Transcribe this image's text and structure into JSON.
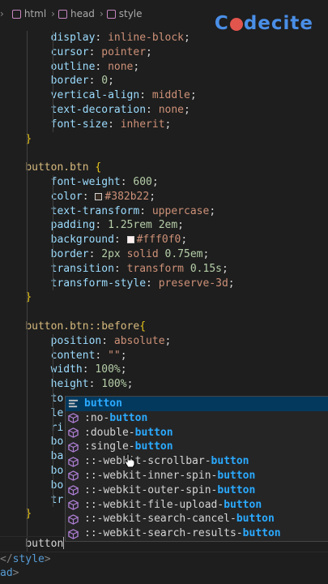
{
  "breadcrumb": {
    "items": [
      {
        "label": "html"
      },
      {
        "label": "head"
      },
      {
        "label": "style"
      }
    ]
  },
  "brand": {
    "logo_text_a": "C",
    "logo_text_b": "decite"
  },
  "colors": {
    "swatch_color": "#382b22",
    "swatch_bg": "#fff0f0",
    "logo_blue": "#4a8fe7",
    "logo_red": "#e2554d",
    "highlight": "#2aaaff"
  },
  "code": {
    "block1": [
      {
        "prop": "display",
        "val": "inline-block"
      },
      {
        "prop": "cursor",
        "val": "pointer"
      },
      {
        "prop": "outline",
        "val": "none"
      },
      {
        "prop": "border",
        "num": "0"
      },
      {
        "prop": "vertical-align",
        "val": "middle"
      },
      {
        "prop": "text-decoration",
        "val": "none"
      },
      {
        "prop": "font-size",
        "val": "inherit"
      }
    ],
    "selector2": "button.btn",
    "block2": [
      {
        "prop": "font-weight",
        "num": "600"
      },
      {
        "prop": "color",
        "val": "#382b22"
      },
      {
        "prop": "text-transform",
        "val": "uppercase"
      },
      {
        "prop": "padding",
        "num": "1.25rem 2em"
      },
      {
        "prop": "background",
        "val": "#fff0f0"
      },
      {
        "prop": "border",
        "num": "2px",
        "val": "solid",
        "num2": "0.75em"
      },
      {
        "prop": "transition",
        "val": "transform",
        "num": "0.15s"
      },
      {
        "prop": "transform-style",
        "val": "preserve-3d"
      }
    ],
    "selector3": "button.btn::before",
    "block3": [
      {
        "prop": "position",
        "val": "absolute"
      },
      {
        "prop": "content",
        "val": "\"\""
      },
      {
        "prop": "width",
        "num": "100%"
      },
      {
        "prop": "height",
        "num": "100%"
      },
      {
        "prop": "to"
      },
      {
        "prop": "le"
      },
      {
        "prop": "ri"
      },
      {
        "prop": "bo"
      },
      {
        "prop": "ba"
      },
      {
        "prop": "bo"
      },
      {
        "prop": "bo"
      },
      {
        "prop": "tr"
      }
    ],
    "typing": "button",
    "close_style_open": "</",
    "close_style_tag": "style",
    "close_style_end": ">",
    "close_head_tag": "ad",
    "close_head_end": ">"
  },
  "suggestions": [
    {
      "prefix": "",
      "match": "button",
      "kind": "text",
      "active": true
    },
    {
      "prefix": ":no-",
      "match": "button",
      "kind": "cube"
    },
    {
      "prefix": ":double-",
      "match": "button",
      "kind": "cube"
    },
    {
      "prefix": ":single-",
      "match": "button",
      "kind": "cube"
    },
    {
      "prefix": "::-webkit-scrollbar-",
      "match": "button",
      "kind": "cube"
    },
    {
      "prefix": "::-webkit-inner-spin-",
      "match": "button",
      "kind": "cube"
    },
    {
      "prefix": "::-webkit-outer-spin-",
      "match": "button",
      "kind": "cube"
    },
    {
      "prefix": "::-webkit-file-upload-",
      "match": "button",
      "kind": "cube"
    },
    {
      "prefix": "::-webkit-search-cancel-",
      "match": "button",
      "kind": "cube"
    },
    {
      "prefix": "::-webkit-search-results-",
      "match": "button",
      "kind": "cube"
    }
  ]
}
